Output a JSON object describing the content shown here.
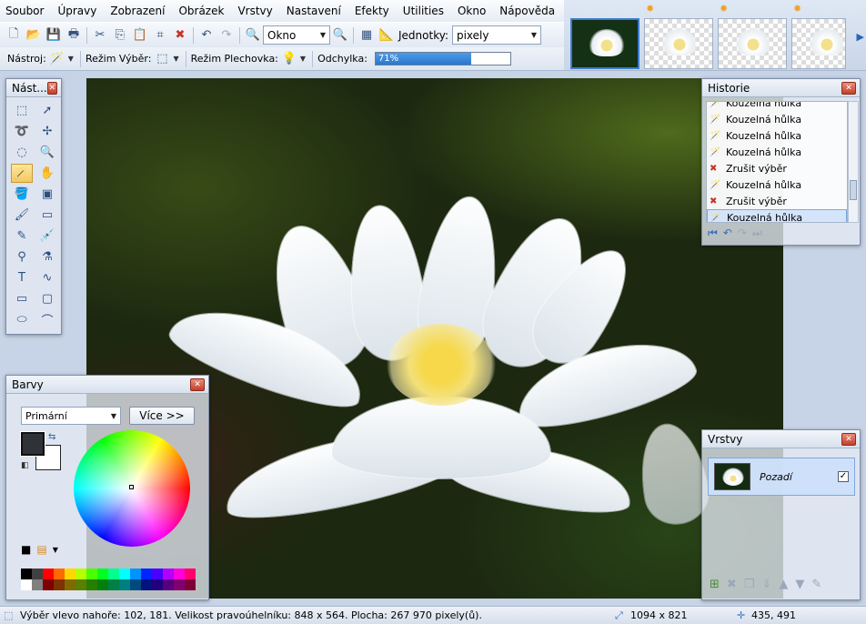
{
  "menu": [
    "Soubor",
    "Úpravy",
    "Zobrazení",
    "Obrázek",
    "Vrstvy",
    "Nastavení",
    "Efekty",
    "Utilities",
    "Okno",
    "Nápověda"
  ],
  "toolbar": {
    "zoom_value": "Okno",
    "units_label": "Jednotky:",
    "units_value": "pixely"
  },
  "toolbar2": {
    "tool_label": "Nástroj:",
    "selection_mode_label": "Režim Výběr:",
    "fill_mode_label": "Režim Plechovka:",
    "tolerance_label": "Odchylka:",
    "tolerance_value": "71%",
    "tolerance_fraction": 0.71
  },
  "windows": {
    "tools_title": "Nást...",
    "history_title": "Historie",
    "colors_title": "Barvy",
    "layers_title": "Vrstvy"
  },
  "history": {
    "items": [
      {
        "label": "Kouzelná hůlka",
        "icon": "magic-wand-icon"
      },
      {
        "label": "Kouzelná hůlka",
        "icon": "magic-wand-icon"
      },
      {
        "label": "Kouzelná hůlka",
        "icon": "magic-wand-icon"
      },
      {
        "label": "Kouzelná hůlka",
        "icon": "magic-wand-icon"
      },
      {
        "label": "Zrušit výběr",
        "icon": "deselect-icon"
      },
      {
        "label": "Kouzelná hůlka",
        "icon": "magic-wand-icon"
      },
      {
        "label": "Zrušit výběr",
        "icon": "deselect-icon"
      },
      {
        "label": "Kouzelná hůlka",
        "icon": "magic-wand-icon"
      }
    ],
    "selected_index": 7
  },
  "colors": {
    "mode_value": "Primární",
    "more_label": "Více >>",
    "primary": "#2f3237",
    "secondary": "#ffffff",
    "palette_row1": [
      "#000000",
      "#404040",
      "#ff0000",
      "#ff6a00",
      "#ffd800",
      "#b6ff00",
      "#4cff00",
      "#00ff21",
      "#00ff90",
      "#00ffff",
      "#0094ff",
      "#0026ff",
      "#4800ff",
      "#b200ff",
      "#ff00dc",
      "#ff006e"
    ],
    "palette_row2": [
      "#ffffff",
      "#808080",
      "#7f0000",
      "#7f3300",
      "#7f6a00",
      "#5b7f00",
      "#267f00",
      "#007f0e",
      "#007f46",
      "#007f7f",
      "#004a7f",
      "#00137f",
      "#21007f",
      "#57007f",
      "#7f006e",
      "#7f0037"
    ]
  },
  "layers": {
    "items": [
      {
        "name": "Pozadí",
        "visible": true
      }
    ]
  },
  "status": {
    "selection_text": "Výběr vlevo nahoře: 102, 181. Velikost pravoúhelníku: 848 x 564. Plocha: 267 970 pixely(ů).",
    "image_size": "1094 x 821",
    "cursor_pos": "435, 491"
  }
}
